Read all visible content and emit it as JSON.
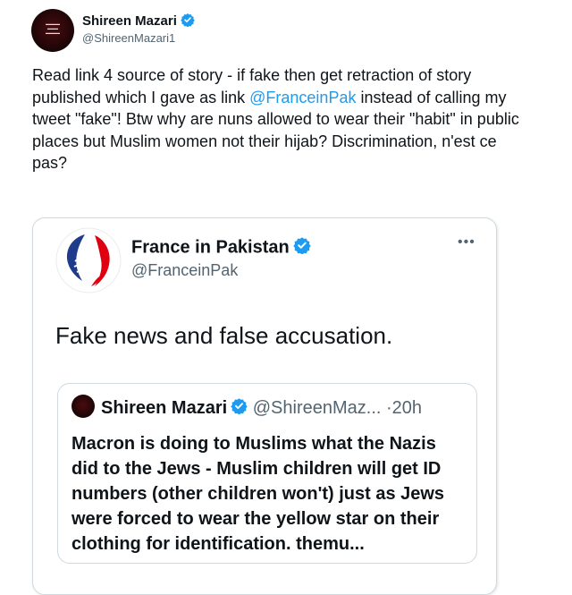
{
  "tweet": {
    "author_name": "Shireen Mazari",
    "author_handle": "@ShireenMazari1",
    "text_part1": "Read link 4 source of story - if fake then get retraction of story published which I gave as link ",
    "mention": "@FranceinPak",
    "text_part2": " instead of calling my tweet \"fake\"! Btw why are nuns allowed to wear their \"habit\" in public places but Muslim women not their hijab? Discrimination, n'est ce pas?"
  },
  "quoted_tweet": {
    "author_name": "France in Pakistan",
    "author_handle": "@FranceinPak",
    "more_icon": "•••",
    "text": "Fake news and false accusation.",
    "embedded": {
      "author_name": "Shireen Mazari",
      "author_handle": "@ShireenMaz...",
      "separator": "·",
      "time": "20h",
      "text": "Macron is doing to Muslims what the Nazis did to the Jews - Muslim children will get ID numbers (other children won't) just as Jews were forced to wear the yellow star on their clothing for identification. themu..."
    }
  },
  "colors": {
    "link": "#1d9bf0",
    "verified": "#1d9bf0",
    "secondary_text": "#536471",
    "border": "#cfd9de"
  },
  "icons": {
    "verified": "verified-badge-icon",
    "more": "more-options-icon"
  }
}
